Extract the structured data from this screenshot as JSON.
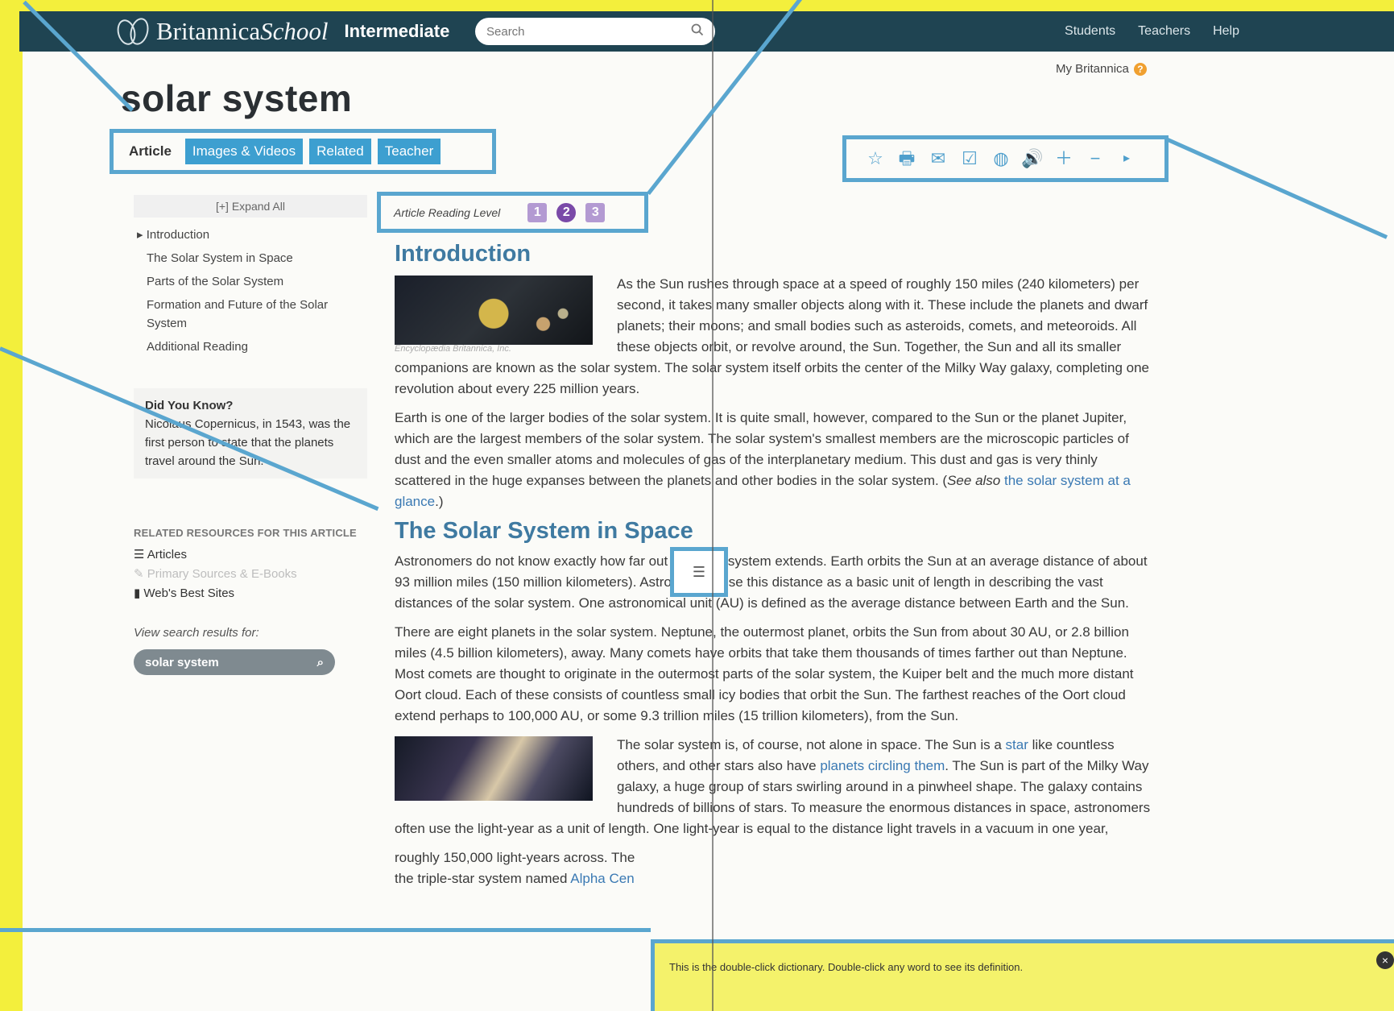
{
  "header": {
    "brand_name": "Britannica",
    "brand_school": "School",
    "level": "Intermediate",
    "search_placeholder": "Search",
    "links": [
      "Students",
      "Teachers",
      "Help"
    ],
    "my_britannica": "My Britannica"
  },
  "article": {
    "title": "solar system",
    "tabs": [
      {
        "label": "Article"
      },
      {
        "label": "Images & Videos"
      },
      {
        "label": "Related"
      },
      {
        "label": "Teacher"
      }
    ],
    "reading_level_label": "Article Reading Level",
    "reading_levels": [
      "1",
      "2",
      "3"
    ],
    "current_reading_level": "2"
  },
  "toolbar": {
    "icons": [
      "star-icon",
      "print-icon",
      "email-icon",
      "citation-icon",
      "translate-icon",
      "audio-icon",
      "zoom-in-icon",
      "zoom-out-icon",
      "chevron-right-icon"
    ]
  },
  "sidebar": {
    "expand_all": "[+] Expand All",
    "toc": [
      "Introduction",
      "The Solar System in Space",
      "Parts of the Solar System",
      "Formation and Future of the Solar System",
      "Additional Reading"
    ],
    "did_you_know_heading": "Did You Know?",
    "did_you_know_text": "Nicolaus Copernicus, in 1543, was the first person to state that the planets travel around the Sun.",
    "related_title": "RELATED RESOURCES FOR THIS ARTICLE",
    "related": [
      {
        "label": "Articles",
        "enabled": true
      },
      {
        "label": "Primary Sources & E-Books",
        "enabled": false
      },
      {
        "label": "Web's Best Sites",
        "enabled": true
      }
    ],
    "view_results_label": "View search results for:",
    "search_term": "solar system"
  },
  "content": {
    "intro_title": "Introduction",
    "intro_caption": "Encyclopædia Britannica, Inc.",
    "intro_p1": "As the Sun rushes through space at a speed of roughly 150 miles (240 kilometers) per second, it takes many smaller objects along with it. These include the planets and dwarf planets; their moons; and small bodies such as asteroids, comets, and meteoroids. All these objects orbit, or revolve around, the Sun. Together, the Sun and all its smaller companions are known as the solar system. The solar system itself orbits the center of the Milky Way galaxy, completing one revolution about every 225 million years.",
    "intro_p2_before_link": "Earth is one of the larger bodies of the solar system. It is quite small, however, compared to the Sun or the planet Jupiter, which are the largest members of the solar system. The solar system's smallest members are the microscopic particles of dust and the even smaller atoms and molecules of gas of the interplanetary medium. This dust and gas is very thinly scattered in the huge expanses between the planets and other bodies in the solar system. (",
    "intro_p2_see_also": "See also",
    "intro_p2_link": "the solar system at a glance",
    "intro_p2_after_link": ".)",
    "space_title": "The Solar System in Space",
    "space_p1": "Astronomers do not know exactly how far out the solar system extends. Earth orbits the Sun at an average distance of about 93 million miles (150 million kilometers). Astronomers use this distance as a basic unit of length in describing the vast distances of the solar system. One astronomical unit (AU) is defined as the average distance between Earth and the Sun.",
    "space_p2": "There are eight planets in the solar system. Neptune, the outermost planet, orbits the Sun from about 30 AU, or 2.8 billion miles (4.5 billion kilometers), away. Many comets have orbits that take them thousands of times farther out than Neptune. Most comets are thought to originate in the outermost parts of the solar system, the Kuiper belt and the much more distant Oort cloud. Each of these consists of countless small icy bodies that orbit the Sun. The farthest reaches of the Oort cloud extend perhaps to 100,000 AU, or some 9.3 trillion miles (15 trillion kilometers), from the Sun.",
    "space_p3_a": "The solar system is, of course, not alone in space. The Sun is a ",
    "space_p3_star": "star",
    "space_p3_b": " like countless others, and other stars also have ",
    "space_p3_planets": "planets circling them",
    "space_p3_c": ". The Sun is part of the Milky Way galaxy, a huge group of stars swirling around in a pinwheel shape. The galaxy contains hundreds of billions of stars. To measure the enormous distances in space, astronomers often use the light-year as a unit of length. One light-year is equal to the distance light travels in a vacuum in one year,",
    "space_p3_d": "roughly 150,000 light-years across. The",
    "space_p3_e": "the triple-star system named ",
    "space_p3_alpha": "Alpha Cen"
  },
  "dictionary": {
    "message": "This is the double-click dictionary. Double-click any word to see its definition.",
    "close": "×"
  }
}
